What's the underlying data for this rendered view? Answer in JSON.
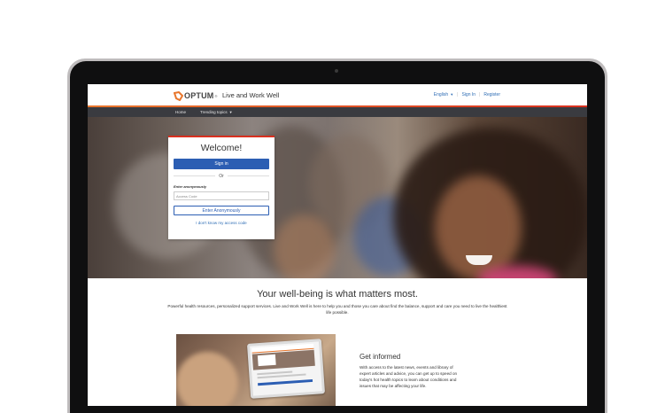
{
  "header": {
    "logo_text": "OPTUM",
    "logo_tm": "®",
    "site_name": "Live and Work Well",
    "language": "English",
    "sign_in": "Sign In",
    "register": "Register"
  },
  "nav": {
    "home": "Home",
    "trending": "Trending topics"
  },
  "login": {
    "title": "Welcome!",
    "sign_in_button": "Sign in",
    "or": "Or",
    "anon_label": "Enter anonymously",
    "access_placeholder": "Access Code",
    "anon_button": "Enter Anonymously",
    "forgot_link": "I don't know my access code"
  },
  "content": {
    "headline": "Your well-being is what matters most.",
    "tagline": "Powerful health resources, personalized support services. Live and Work Well is here to help you and those you care about find the balance, support and care you need to live the healthiest life possible.",
    "feature_title": "Get informed",
    "feature_text": "With access to the latest news, events and library of expert articles and advice, you can get up to speed on today's hot health topics to learn about conditions and issues that may be affecting your life."
  },
  "colors": {
    "brand_orange": "#e8762c",
    "brand_red": "#d9301f",
    "primary_blue": "#2c5eb3",
    "nav_dark": "#3a3b40"
  },
  "icons": {
    "language_dropdown": "chevron-down-icon",
    "trending_dropdown": "chevron-down-icon",
    "logo": "optum-logo-icon"
  }
}
